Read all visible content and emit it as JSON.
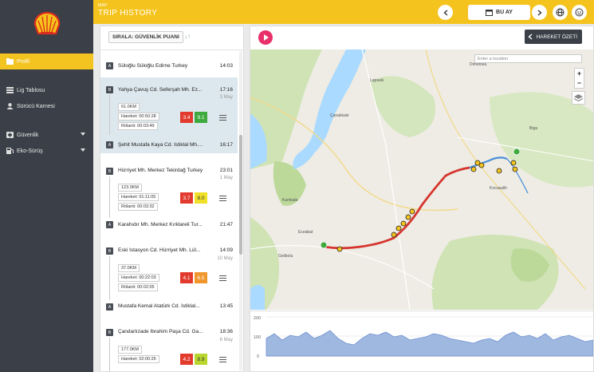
{
  "sidebar": {
    "items": [
      {
        "label": "Profil",
        "icon": "folder-icon"
      },
      {
        "label": "Lig Tablosu",
        "icon": "list-icon"
      },
      {
        "label": "Sürücü Karnesi",
        "icon": "user-icon"
      },
      {
        "label": "Güvenlik",
        "icon": "plus-shield-icon"
      },
      {
        "label": "Eko-Sürüş",
        "icon": "fuel-icon"
      }
    ]
  },
  "header": {
    "small_label": "MAP",
    "title": "TRIP HISTORY",
    "period_label": "BU AY"
  },
  "trip_list": {
    "sort_label": "SIRALA: GÜVENLİK PUANI",
    "trips": [
      {
        "start_letter": "A",
        "start_addr": "Süloğlu Süloğlu Edirne Turkey",
        "start_time": "14:03"
      },
      {
        "start_letter": "B",
        "start_addr": "Yahya Çavuş Cd. Seferşah Mh. Ez...",
        "start_time": "17:16",
        "date": "3 May",
        "distance": "61.0KM",
        "hareket": "Hareket: 00:50:28",
        "rolanti": "Rölanti: 00:03:49",
        "score1": "3.4",
        "score2": "9.1",
        "end_letter": "A",
        "end_addr": "Şehit Mustafa Kaya Cd. İstiklal Mh....",
        "end_time": "16:17"
      },
      {
        "start_letter": "B",
        "start_addr": "Hürriyet Mh. Merkez Tekirdağ Turkey",
        "start_time": "23:01",
        "date": "1 May",
        "distance": "123.0KM",
        "hareket": "Hareket: 01:11:05",
        "rolanti": "Rölanti: 00:03:32",
        "score1": "3.7",
        "score2": "8.0",
        "end_letter": "A",
        "end_addr": "Karahıdır Mh. Merkez Kırklareli Tur...",
        "end_time": "21:47"
      },
      {
        "start_letter": "B",
        "start_addr": "Eski İstasyon Cd. Hürriyet Mh. Lül...",
        "start_time": "14:09",
        "date": "10 May",
        "distance": "37.0KM",
        "hareket": "Hareket: 00:22:03",
        "rolanti": "Rölanti: 00:02:05",
        "score1": "4.1",
        "score2": "6.5",
        "end_letter": "A",
        "end_addr": "Mustafa Kemal Atatürk Cd. İstiklal...",
        "end_time": "13:45"
      },
      {
        "start_letter": "B",
        "start_addr": "Çandarlızade İbrahim Paşa Cd. Ga...",
        "start_time": "18:36",
        "date": "6 May",
        "distance": "177.0KM",
        "hareket": "Hareket: 02:00:25",
        "score1": "4.2",
        "score2": "8.9"
      }
    ]
  },
  "map": {
    "summary_label": "HAREKET ÖZETİ",
    "search_placeholder": "Enter a location",
    "zoom_in": "+",
    "zoom_out": "−",
    "route_color": "#d6342e",
    "place_labels": [
      "Çanakkale",
      "Eceabat",
      "Lapseki",
      "Gelibolu",
      "Kumkale",
      "Biga",
      "Dimetoka",
      "Kırcasalih"
    ]
  },
  "elevation_chart": {
    "y_ticks": [
      "200",
      "100",
      "0"
    ]
  },
  "colors": {
    "accent": "#f5c31d",
    "sidebar": "#3b4048",
    "score_red": "#e23b2e",
    "score_green": "#3eaa3e",
    "score_yellow": "#f1e02a",
    "score_orange": "#f0962c"
  }
}
